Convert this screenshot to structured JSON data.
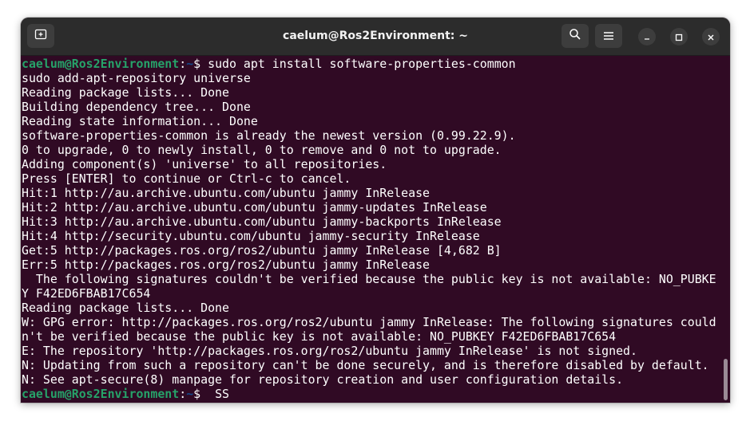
{
  "window": {
    "title": "caelum@Ros2Environment: ~"
  },
  "titlebar": {
    "new_tab_icon": "new-tab-icon",
    "search_icon": "search-icon",
    "menu_icon": "hamburger-menu-icon",
    "minimize_icon": "minimize-icon",
    "maximize_icon": "maximize-icon",
    "close_icon": "close-icon"
  },
  "colors": {
    "terminal_bg": "#300a24",
    "titlebar_bg": "#2c2c2c",
    "prompt_user": "#26a269",
    "prompt_path": "#12488b",
    "text": "#ffffff"
  },
  "terminal": {
    "prompt_user": "caelum@Ros2Environment",
    "prompt_path": "~",
    "first_command": "sudo apt install software-properties-common",
    "output": [
      "sudo add-apt-repository universe",
      "Reading package lists... Done",
      "Building dependency tree... Done",
      "Reading state information... Done",
      "software-properties-common is already the newest version (0.99.22.9).",
      "0 to upgrade, 0 to newly install, 0 to remove and 0 not to upgrade.",
      "Adding component(s) 'universe' to all repositories.",
      "Press [ENTER] to continue or Ctrl-c to cancel.",
      "Hit:1 http://au.archive.ubuntu.com/ubuntu jammy InRelease",
      "Hit:2 http://au.archive.ubuntu.com/ubuntu jammy-updates InRelease",
      "Hit:3 http://au.archive.ubuntu.com/ubuntu jammy-backports InRelease",
      "Hit:4 http://security.ubuntu.com/ubuntu jammy-security InRelease",
      "Get:5 http://packages.ros.org/ros2/ubuntu jammy InRelease [4,682 B]",
      "Err:5 http://packages.ros.org/ros2/ubuntu jammy InRelease",
      "  The following signatures couldn't be verified because the public key is not available: NO_PUBKE",
      "Y F42ED6FBAB17C654",
      "Reading package lists... Done",
      "W: GPG error: http://packages.ros.org/ros2/ubuntu jammy InRelease: The following signatures could",
      "n't be verified because the public key is not available: NO_PUBKEY F42ED6FBAB17C654",
      "E: The repository 'http://packages.ros.org/ros2/ubuntu jammy InRelease' is not signed.",
      "N: Updating from such a repository can't be done securely, and is therefore disabled by default.",
      "N: See apt-secure(8) manpage for repository creation and user configuration details."
    ],
    "current_input": " SS"
  }
}
